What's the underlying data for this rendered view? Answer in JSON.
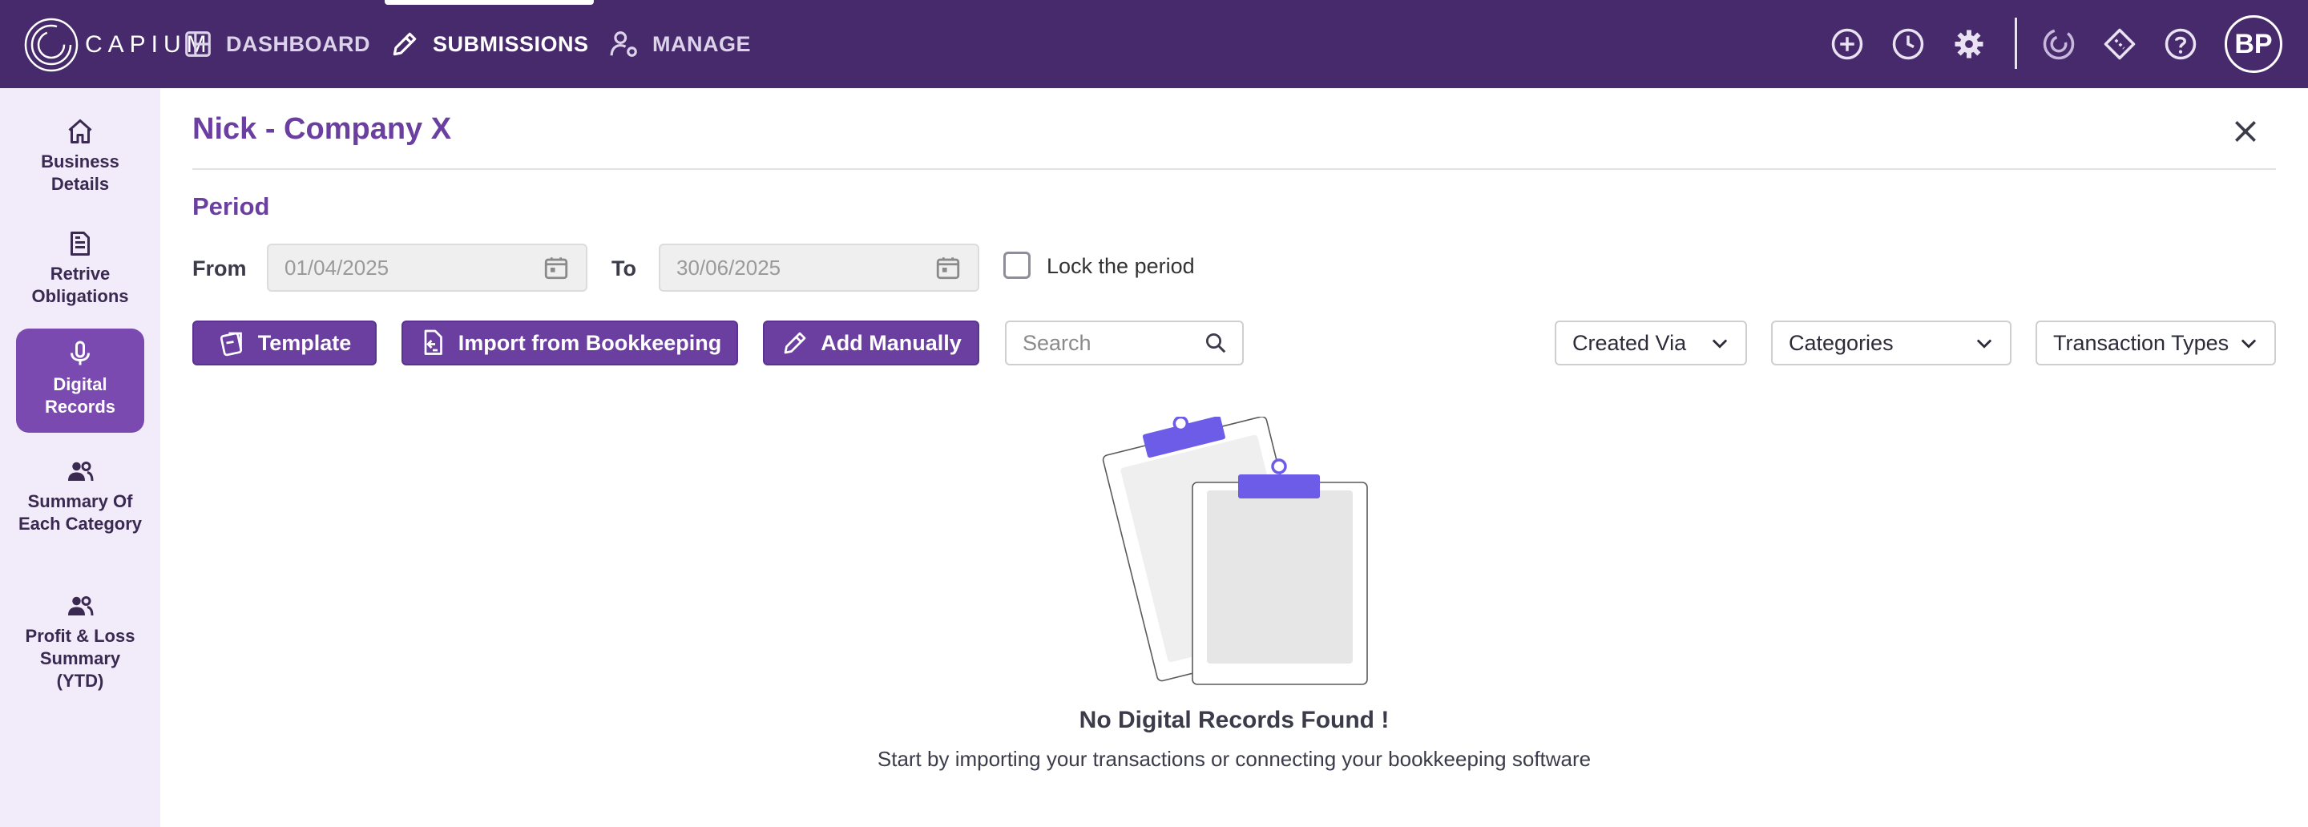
{
  "app": {
    "logo_text": "CAPIUM",
    "user_initials": "BP"
  },
  "nav": {
    "dashboard": "DASHBOARD",
    "submissions": "SUBMISSIONS",
    "manage": "MANAGE"
  },
  "sidebar": {
    "items": [
      {
        "label": "Business Details",
        "icon": "home-icon"
      },
      {
        "label": "Retrive Obligations",
        "icon": "document-icon"
      },
      {
        "label": "Digital Records",
        "icon": "microphone-icon",
        "active": true
      },
      {
        "label": "Summary Of Each Category",
        "icon": "users-icon"
      },
      {
        "label": "Profit & Loss Summary (YTD)",
        "icon": "users-icon"
      }
    ]
  },
  "main": {
    "title": "Nick - Company X",
    "period_heading": "Period",
    "from_label": "From",
    "from_value": "01/04/2025",
    "to_label": "To",
    "to_value": "30/06/2025",
    "lock_label": "Lock the period",
    "lock_checked": false
  },
  "toolbar": {
    "template": "Template",
    "import": "Import from Bookkeeping",
    "add_manually": "Add Manually",
    "search_placeholder": "Search",
    "created_via": "Created Via",
    "categories": "Categories",
    "transaction_types": "Transaction Types"
  },
  "empty_state": {
    "title": "No Digital Records Found !",
    "subtitle": "Start by importing your transactions or connecting your bookkeeping software"
  },
  "colors": {
    "brand_dark": "#472a6b",
    "brand": "#6b3fa0",
    "sidebar_bg": "#f2ecfa",
    "illustration_accent": "#6c5ce7"
  }
}
